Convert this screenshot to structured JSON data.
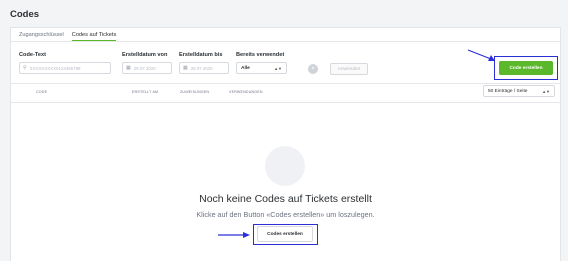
{
  "page": {
    "title": "Codes"
  },
  "tabs": [
    {
      "label": "Zugangsschlüssel",
      "active": false
    },
    {
      "label": "Codes auf Tickets",
      "active": true
    }
  ],
  "filters": {
    "code_text": {
      "label": "Code-Text",
      "placeholder": "XXXXXXXXX0123456789"
    },
    "date_from": {
      "label": "Erstelldatum von",
      "placeholder": "29.07.2020"
    },
    "date_to": {
      "label": "Erstelldatum bis",
      "placeholder": "29.07.2020"
    },
    "used": {
      "label": "Bereits verwendet",
      "selected": "Alle"
    },
    "apply_label": "Anwenden"
  },
  "actions": {
    "create_label": "Code erstellen"
  },
  "table": {
    "columns": [
      "Code",
      "Erstellt am",
      "Zuweisungen",
      "Verwendungen"
    ],
    "per_page": "50 Einträge / Seite"
  },
  "empty_state": {
    "title": "Noch keine Codes auf Tickets erstellt",
    "subtitle": "Klicke auf den Button «Codes erstellen» um loszulegen.",
    "button_label": "Codes erstellen"
  },
  "colors": {
    "accent": "#5cb82b",
    "highlight": "#2c2fd6"
  }
}
